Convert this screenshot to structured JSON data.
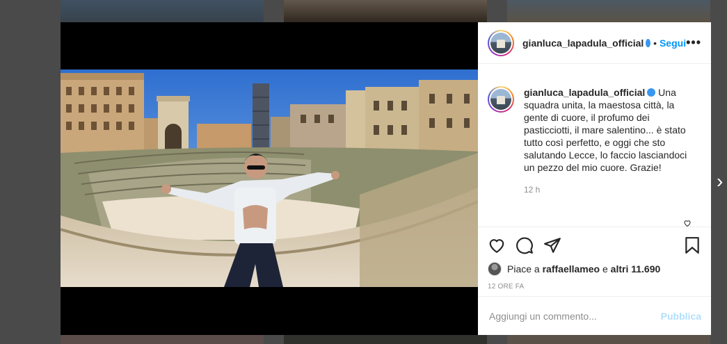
{
  "post": {
    "username": "gianluca_lapadula_official",
    "follow_label": "Segui",
    "more_label": "•••",
    "caption": "Una squadra unita, la maestosa città, la gente di cuore, il profumo dei pasticciotti, il mare salentino... è stato tutto così perfetto, e oggi che sto salutando Lecce, lo faccio lasciandoci un pezzo del mio cuore. Grazie!",
    "caption_time": "12 h",
    "likes_prefix": "Piace a",
    "likes_user": "raffaellameo",
    "likes_connector": "e",
    "likes_others": "altri 11.690",
    "date": "12 ORE FA",
    "comment_placeholder": "Aggiungi un commento...",
    "publish_label": "Pubblica"
  },
  "icons": {
    "like": "heart-icon",
    "comment": "comment-icon",
    "share": "share-icon",
    "save": "bookmark-icon",
    "next": "chevron-right-icon"
  },
  "colors": {
    "link": "#0095f6",
    "verified": "#3897f0",
    "publish_disabled": "#b2dffc"
  }
}
